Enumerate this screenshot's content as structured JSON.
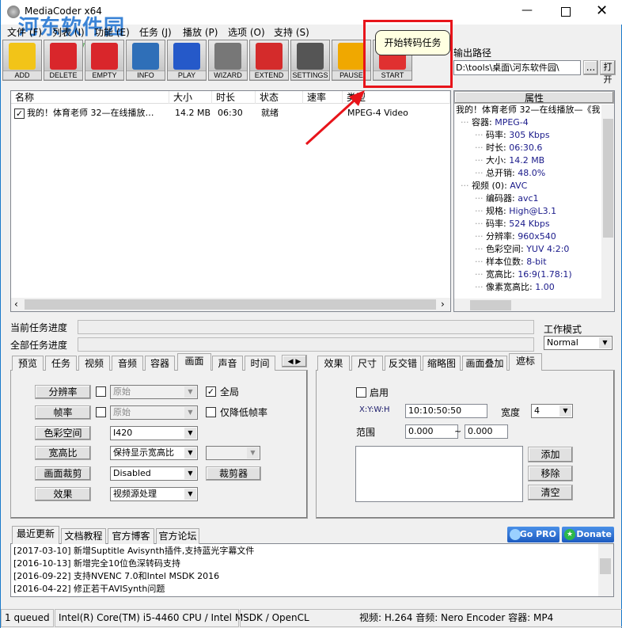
{
  "window": {
    "title": "MediaCoder x64",
    "watermark": "河东软件园",
    "watermark_url": "www.pc0359.cn"
  },
  "menu": [
    "文件 (F)",
    "列表 (I)",
    "功能 (E)",
    "任务 (J)",
    "播放 (P)",
    "选项 (O)",
    "支持 (S)"
  ],
  "toolbar": [
    {
      "label": "ADD",
      "icon": "add-icon",
      "color": "#f2c418"
    },
    {
      "label": "DELETE",
      "icon": "delete-icon",
      "color": "#d9262b"
    },
    {
      "label": "EMPTY",
      "icon": "empty-icon",
      "color": "#d9262b"
    },
    {
      "label": "INFO",
      "icon": "info-icon",
      "color": "#2f6fb8"
    },
    {
      "label": "PLAY",
      "icon": "play-icon",
      "color": "#2559c9"
    },
    {
      "label": "WIZARD",
      "icon": "wizard-icon",
      "color": "#777777"
    },
    {
      "label": "EXTEND",
      "icon": "extend-icon",
      "color": "#d42b2b"
    },
    {
      "label": "SETTINGS",
      "icon": "settings-icon",
      "color": "#555555"
    },
    {
      "label": "PAUSE",
      "icon": "pause-icon",
      "color": "#f0a800"
    },
    {
      "label": "START",
      "icon": "start-icon",
      "color": "#e03030"
    }
  ],
  "tooltip": "开始转码任务",
  "output": {
    "label": "输出路径",
    "path": "D:\\tools\\桌面\\河东软件园\\",
    "browse": "...",
    "open": "打开"
  },
  "filelist": {
    "columns": [
      "名称",
      "大小",
      "时长",
      "状态",
      "速率",
      "类型"
    ],
    "rows": [
      {
        "checked": true,
        "name": "我的！体育老师 32—在线播放…",
        "size": "14.2 MB",
        "duration": "06:30",
        "status": "就绪",
        "rate": "",
        "type": "MPEG-4 Video"
      }
    ]
  },
  "properties": {
    "header": "属性",
    "title": "我的！体育老师 32—在线播放—《我",
    "items": [
      {
        "level": 1,
        "key": "容器: ",
        "value": "MPEG-4"
      },
      {
        "level": 2,
        "key": "码率: ",
        "value": "305 Kbps"
      },
      {
        "level": 2,
        "key": "时长: ",
        "value": "06:30.6"
      },
      {
        "level": 2,
        "key": "大小: ",
        "value": "14.2 MB"
      },
      {
        "level": 2,
        "key": "总开销: ",
        "value": "48.0%"
      },
      {
        "level": 1,
        "key": "视频 (0): ",
        "value": "AVC"
      },
      {
        "level": 2,
        "key": "编码器: ",
        "value": "avc1"
      },
      {
        "level": 2,
        "key": "规格: ",
        "value": "High@L3.1"
      },
      {
        "level": 2,
        "key": "码率: ",
        "value": "524 Kbps"
      },
      {
        "level": 2,
        "key": "分辨率: ",
        "value": "960x540"
      },
      {
        "level": 2,
        "key": "色彩空间: ",
        "value": "YUV 4:2:0"
      },
      {
        "level": 2,
        "key": "样本位数: ",
        "value": "8-bit"
      },
      {
        "level": 2,
        "key": "宽高比: ",
        "value": "16:9(1.78:1)"
      },
      {
        "level": 2,
        "key": "像素宽高比: ",
        "value": "1.00"
      }
    ]
  },
  "progress": {
    "current_label": "当前任务进度",
    "total_label": "全部任务进度",
    "current": 0,
    "total": 0,
    "mode_label": "工作模式",
    "mode": "Normal"
  },
  "left_tabs": [
    "预览",
    "任务",
    "视频",
    "音频",
    "容器",
    "画面",
    "声音",
    "时间"
  ],
  "left_active": 5,
  "picture": {
    "resolution": "分辨率",
    "resolution_value": "原始",
    "framerate": "帧率",
    "framerate_value": "原始",
    "global": "全局",
    "global_checked": true,
    "reduce_only": "仅降低帧率",
    "colorspace": "色彩空间",
    "colorspace_value": "I420",
    "aspect": "宽高比",
    "aspect_value": "保持显示宽高比",
    "crop": "画面裁剪",
    "crop_value": "Disabled",
    "cropper": "裁剪器",
    "effect": "效果",
    "effect_value": "视频源处理"
  },
  "right_tabs": [
    "效果",
    "尺寸",
    "反交错",
    "缩略图",
    "画面叠加",
    "遮标"
  ],
  "right_active": 5,
  "delogo": {
    "enable": "启用",
    "xywh_label": "X:Y:W:H",
    "xywh": "10:10:50:50",
    "width_label": "宽度",
    "width": "4",
    "range_label": "范围",
    "range_from": "0.000",
    "range_sep": "~",
    "range_to": "0.000",
    "add": "添加",
    "remove": "移除",
    "clear": "清空"
  },
  "bottom_tabs": [
    "最近更新",
    "文档教程",
    "官方博客",
    "官方论坛"
  ],
  "gopro": "Go PRO",
  "donate": "Donate",
  "news": [
    "[2017-03-10] 新增Suptitle Avisynth插件,支持蓝光字幕文件",
    "[2016-10-13] 新增完全10位色深转码支持",
    "[2016-09-22] 支持NVENC 7.0和Intel MSDK 2016",
    "[2016-04-22] 修正若干AVISynth问题"
  ],
  "status": {
    "queue": "1 queued",
    "hw": "Intel(R) Core(TM) i5-4460 CPU  / Intel MSDK / OpenCL",
    "codecs": "视频: H.264  音频: Nero Encoder  容器: MP4"
  }
}
